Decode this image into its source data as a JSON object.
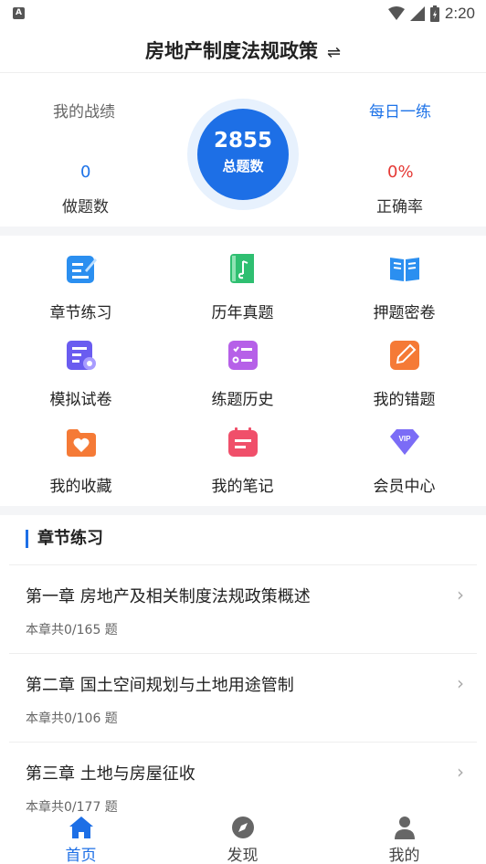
{
  "status_bar": {
    "time": "2:20",
    "left_badge": "A"
  },
  "header": {
    "title": "房地产制度法规政策",
    "swap_symbol": "⇌"
  },
  "stats": {
    "my_record_label": "我的战绩",
    "daily_practice_label": "每日一练",
    "done_count": "0",
    "done_label": "做题数",
    "total_count": "2855",
    "total_label": "总题数",
    "accuracy": "0%",
    "accuracy_label": "正确率"
  },
  "grid": {
    "items": [
      {
        "label": "章节练习",
        "icon": "edit-icon",
        "color": "#2b8ff0"
      },
      {
        "label": "历年真题",
        "icon": "book-note-icon",
        "color": "#2fbf71"
      },
      {
        "label": "押题密卷",
        "icon": "open-book-icon",
        "color": "#2b8ff0"
      },
      {
        "label": "模拟试卷",
        "icon": "document-gear-icon",
        "color": "#6a5cf0"
      },
      {
        "label": "练题历史",
        "icon": "checklist-icon",
        "color": "#b660e8"
      },
      {
        "label": "我的错题",
        "icon": "pencil-icon",
        "color": "#f57a36"
      },
      {
        "label": "我的收藏",
        "icon": "heart-folder-icon",
        "color": "#f57a36"
      },
      {
        "label": "我的笔记",
        "icon": "notes-icon",
        "color": "#f04f6a"
      },
      {
        "label": "会员中心",
        "icon": "vip-diamond-icon",
        "color": "#7b6cf6"
      }
    ]
  },
  "section": {
    "title": "章节练习",
    "chapters": [
      {
        "title": "第一章 房地产及相关制度法规政策概述",
        "sub": "本章共0/165 题"
      },
      {
        "title": "第二章 国土空间规划与土地用途管制",
        "sub": "本章共0/106 题"
      },
      {
        "title": "第三章 土地与房屋征收",
        "sub": "本章共0/177 题"
      }
    ]
  },
  "bottom_nav": {
    "tabs": [
      {
        "label": "首页",
        "icon": "home-icon",
        "active": true
      },
      {
        "label": "发现",
        "icon": "compass-icon",
        "active": false
      },
      {
        "label": "我的",
        "icon": "user-icon",
        "active": false
      }
    ]
  },
  "colors": {
    "accent": "#1d6fe6",
    "accuracy_red": "#e53935",
    "divider": "#f4f5f7"
  }
}
